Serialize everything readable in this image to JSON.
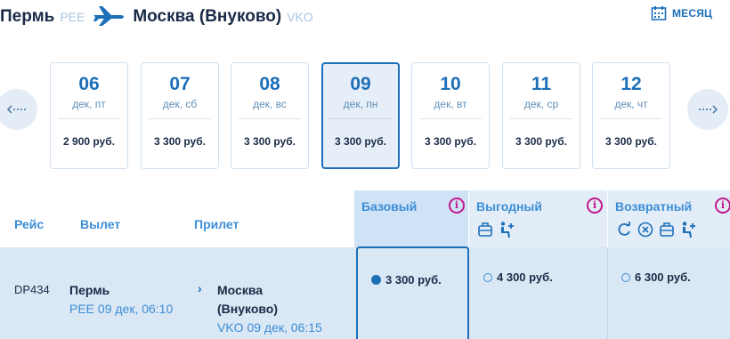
{
  "route": {
    "from_city": "Пермь",
    "from_code": "PEE",
    "to_city": "Москва (Внуково)",
    "to_code": "VKO"
  },
  "month_button": {
    "label": "МЕСЯЦ"
  },
  "dates": [
    {
      "day": "06",
      "dow": "дек, пт",
      "price": "2 900 руб."
    },
    {
      "day": "07",
      "dow": "дек, сб",
      "price": "3 300 руб."
    },
    {
      "day": "08",
      "dow": "дек, вс",
      "price": "3 300 руб."
    },
    {
      "day": "09",
      "dow": "дек, пн",
      "price": "3 300 руб."
    },
    {
      "day": "10",
      "dow": "дек, вт",
      "price": "3 300 руб."
    },
    {
      "day": "11",
      "dow": "дек, ср",
      "price": "3 300 руб."
    },
    {
      "day": "12",
      "dow": "дек, чт",
      "price": "3 300 руб."
    }
  ],
  "selected_date_index": 3,
  "nav": {
    "prev_icon": "arrow-left-icon",
    "next_icon": "arrow-right-icon",
    "prev_glyph": "⋯",
    "next_glyph": "⋯"
  },
  "table": {
    "col_flight": "Рейс",
    "col_departure": "Вылет",
    "col_arrival": "Прилет"
  },
  "tariffs": [
    {
      "name": "Базовый",
      "info": "i",
      "icons": []
    },
    {
      "name": "Выгодный",
      "info": "i",
      "icons": [
        "baggage-icon",
        "seat-icon"
      ]
    },
    {
      "name": "Возвратный",
      "info": "i",
      "icons": [
        "refund-icon",
        "cancel-icon",
        "baggage-icon",
        "seat-icon"
      ]
    }
  ],
  "flight": {
    "code": "DP434",
    "dep_city": "Пермь",
    "dep_sub": "PEE 09 дек, 06:10",
    "arr_city_line1": "Москва",
    "arr_city_line2": "(Внуково)",
    "arr_sub": "VKO 09 дек, 06:15",
    "arrow": "›",
    "fares": [
      {
        "price": "3 300 руб.",
        "selected": true
      },
      {
        "price": "4 300 руб.",
        "selected": false
      },
      {
        "price": "6 300 руб.",
        "selected": false
      }
    ]
  },
  "colors": {
    "accent": "#1d6fb8",
    "link": "#3d8ed6",
    "info": "#c2188b",
    "row_bg": "#dae7f4"
  }
}
